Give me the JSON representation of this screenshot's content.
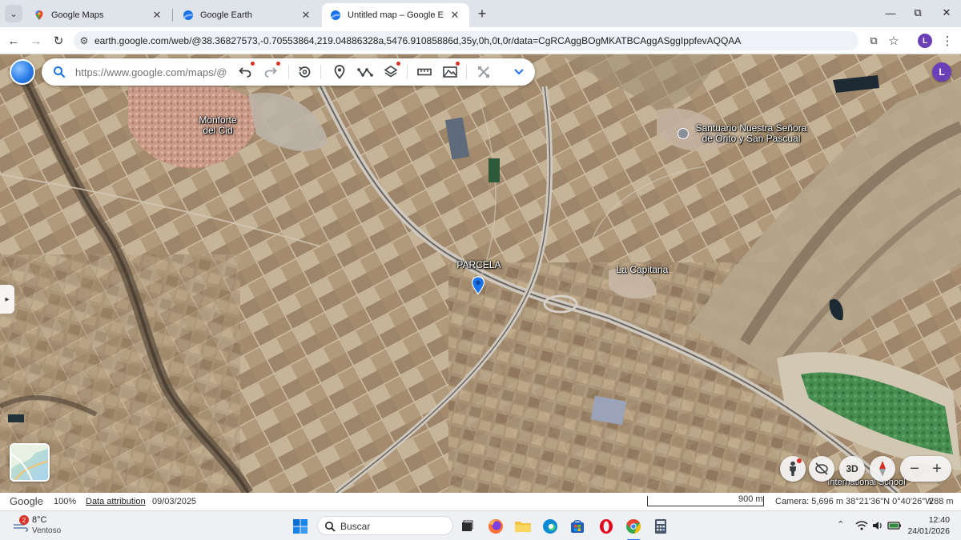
{
  "browser": {
    "tabs": [
      {
        "label": "Google Maps",
        "icon": "google-maps-pin-icon",
        "active": false
      },
      {
        "label": "Google Earth",
        "icon": "google-earth-icon",
        "active": false
      },
      {
        "label": "Untitled map – Google Earth",
        "icon": "google-earth-icon",
        "active": true
      }
    ],
    "url": "earth.google.com/web/@38.36827573,-0.70553864,219.04886328a,5476.91085886d,35y,0h,0t,0r/data=CgRCAggBOgMKATBCAggASggIppfevAQQAA",
    "profile_initial": "L"
  },
  "earth": {
    "search_placeholder": "https://www.google.com/maps/@",
    "account_initial": "L",
    "view_3d_label": "3D",
    "map_labels": {
      "town": "Monforte\ndel Cid",
      "sanctuary": "Santuario Nuestra Señora\nde Orito y San Pascual",
      "parcela": "PARCELA",
      "capitana": "La Capitana",
      "school": "International School"
    },
    "colors": {
      "accent_blue": "#1a73e8",
      "placemark": "#1a73e8",
      "badge_red": "#d93025"
    }
  },
  "status": {
    "google": "Google",
    "zoom": "100%",
    "attribution": "Data attribution",
    "imagery_date": "09/03/2025",
    "scale": "900 m",
    "camera": "Camera: 5,696 m",
    "coords": "38°21'36\"N 0°40'26\"W",
    "elevation": "288 m"
  },
  "taskbar": {
    "weather_badge": "2",
    "temperature": "8°C",
    "condition": "Ventoso",
    "search_label": "Buscar",
    "time": "12:40",
    "date": "24/01/2026"
  }
}
